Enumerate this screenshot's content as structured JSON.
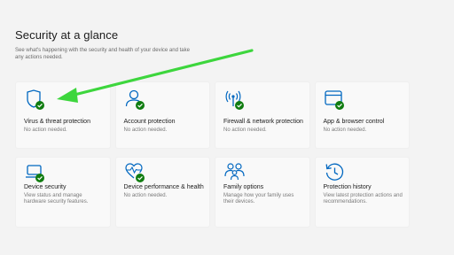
{
  "header": {
    "title": "Security at a glance",
    "subtitle": "See what's happening with the security and health of your device and take any actions needed."
  },
  "cards": [
    {
      "icon": "shield-icon",
      "label": "Virus & threat protection",
      "desc": "No action needed.",
      "status": "ok"
    },
    {
      "icon": "person-icon",
      "label": "Account protection",
      "desc": "No action needed.",
      "status": "ok"
    },
    {
      "icon": "wifi-antenna-icon",
      "label": "Firewall & network protection",
      "desc": "No action needed.",
      "status": "ok"
    },
    {
      "icon": "app-browser-icon",
      "label": "App & browser control",
      "desc": "No action needed.",
      "status": "ok"
    },
    {
      "icon": "laptop-icon",
      "label": "Device security",
      "desc": "View status and manage hardware security features.",
      "status": "ok"
    },
    {
      "icon": "heart-pulse-icon",
      "label": "Device performance & health",
      "desc": "No action needed.",
      "status": "ok"
    },
    {
      "icon": "family-icon",
      "label": "Family options",
      "desc": "Manage how your family uses their devices.",
      "status": "none"
    },
    {
      "icon": "history-icon",
      "label": "Protection history",
      "desc": "View latest protection actions and recommendations.",
      "status": "none"
    }
  ],
  "colors": {
    "accent": "#0067c0",
    "check_green": "#107c10",
    "arrow_green": "#3dd63d"
  }
}
